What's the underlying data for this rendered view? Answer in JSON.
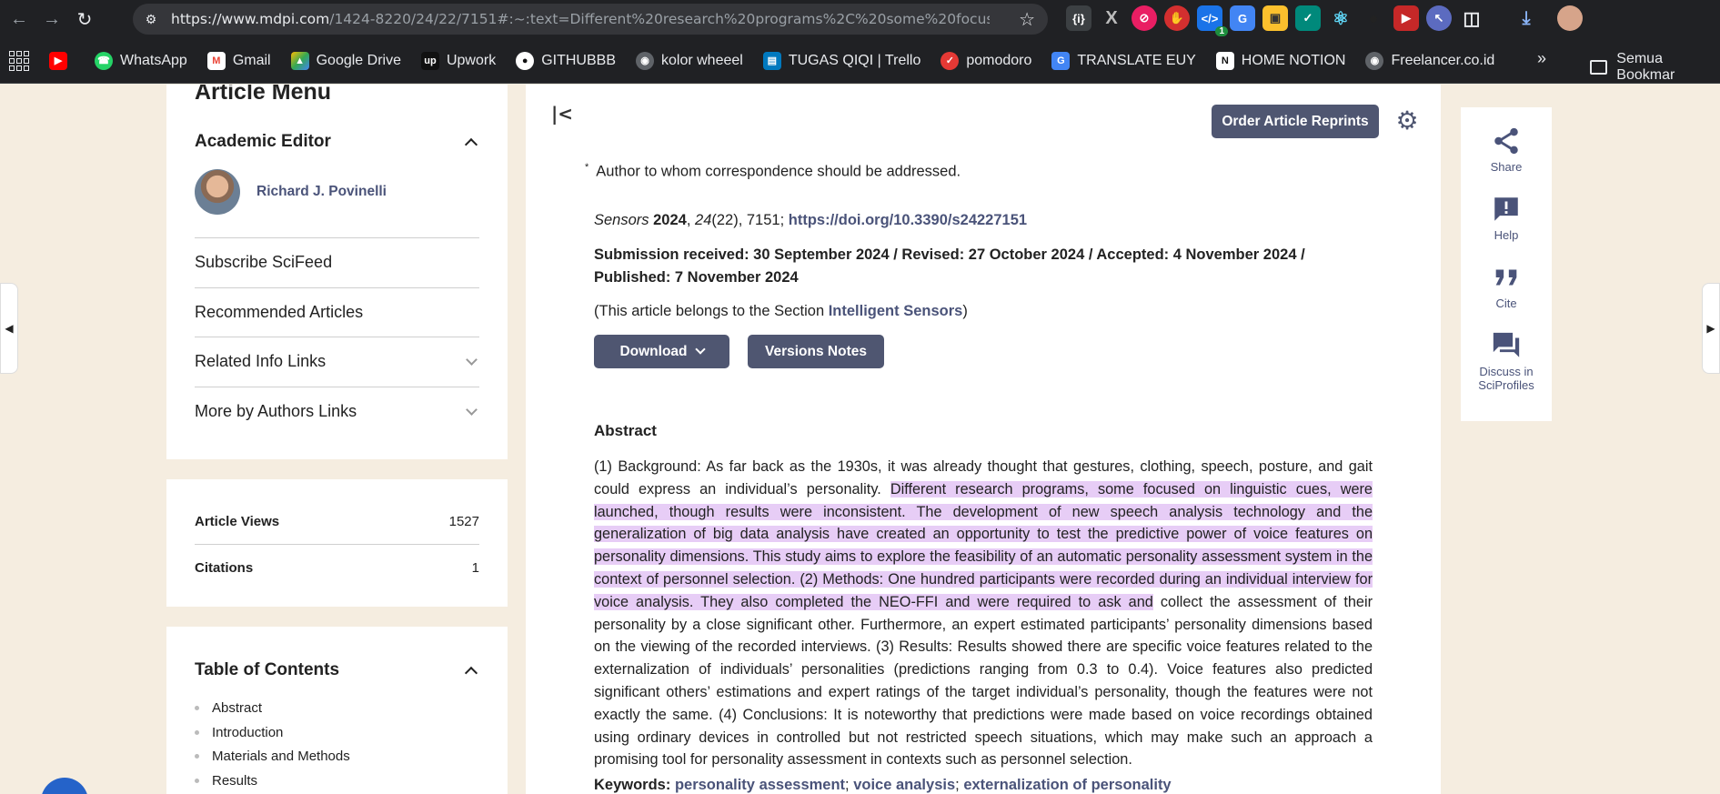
{
  "browser": {
    "url_host": "https://www.mdpi.com",
    "url_rest": "/1424-8220/24/22/7151#:~:text=Different%20research%20programs%2C%20some%20focus...",
    "extension_badge": "1",
    "bookmarks": [
      {
        "label": "",
        "icon": "youtube-icon",
        "color": "#ff0000"
      },
      {
        "label": "WhatsApp",
        "icon": "whatsapp-icon",
        "color": "#25d366"
      },
      {
        "label": "Gmail",
        "icon": "gmail-icon",
        "color": "#ea4335"
      },
      {
        "label": "Google Drive",
        "icon": "google-drive-icon",
        "color": "#fbbc04"
      },
      {
        "label": "Upwork",
        "icon": "upwork-icon",
        "color": "#111111"
      },
      {
        "label": "GITHUBBB",
        "icon": "github-icon",
        "color": "#111111"
      },
      {
        "label": "kolor wheeel",
        "icon": "globe-icon",
        "color": "#5f6368"
      },
      {
        "label": "TUGAS QIQI | Trello",
        "icon": "trello-icon",
        "color": "#0079bf"
      },
      {
        "label": "pomodoro",
        "icon": "pomodoro-icon",
        "color": "#e53935"
      },
      {
        "label": "TRANSLATE EUY",
        "icon": "translate-icon",
        "color": "#4285f4"
      },
      {
        "label": "HOME NOTION",
        "icon": "notion-icon",
        "color": "#ffffff"
      },
      {
        "label": "Freelancer.co.id",
        "icon": "globe-icon",
        "color": "#5f6368"
      }
    ],
    "bookmarks_folder": "Semua Bookmar"
  },
  "sidebar": {
    "menu_title": "Article Menu",
    "academic_editor_heading": "Academic Editor",
    "editor_name": "Richard J. Povinelli",
    "menu_items": [
      "Subscribe SciFeed",
      "Recommended Articles",
      "Related Info Links",
      "More by Authors Links"
    ],
    "stats": [
      {
        "label": "Article Views",
        "value": "1527"
      },
      {
        "label": "Citations",
        "value": "1"
      }
    ],
    "toc_heading": "Table of Contents",
    "toc_items": [
      "Abstract",
      "Introduction",
      "Materials and Methods",
      "Results"
    ]
  },
  "article": {
    "reprint_button": "Order Article Reprints",
    "corresponding_mark": "*",
    "corresponding_note": "Author to whom correspondence should be addressed.",
    "journal": "Sensors",
    "year": "2024",
    "volume": "24",
    "issue_article": "(22), 7151; ",
    "doi": "https://doi.org/10.3390/s24227151",
    "dates_line1": "Submission received: 30 September 2024 / Revised: 27 October 2024 / Accepted: 4 November 2024 /",
    "dates_line2": "Published: 7 November 2024",
    "section_prefix": "(This article belongs to the Section ",
    "section_name": "Intelligent Sensors",
    "section_suffix": ")",
    "download_button": "Download",
    "versions_button": "Versions Notes",
    "abstract_title": "Abstract",
    "abstract_before": "(1) Background: As far back as the 1930s, it was already thought that gestures, clothing, speech, posture, and gait could express an individual’s personality. ",
    "abstract_highlight": "Different research programs, some focused on linguistic cues, were launched, though results were inconsistent. The development of new speech analysis technology and the generalization of big data analysis have created an opportunity to test the predictive power of voice features on personality dimensions. This study aims to explore the feasibility of an automatic personality assessment system in the context of personnel selection. (2) Methods: One hundred participants were recorded during an individual interview for voice analysis. They also completed the NEO-FFI and were required to ask and",
    "abstract_after": " collect the assessment of their personality by a close significant other. Furthermore, an expert estimated participants’ personality dimensions based on the viewing of the recorded interviews. (3) Results: Results showed there are specific voice features related to the externalization of individuals’ personalities (predictions ranging from 0.3 to 0.4). Voice features also predicted significant others’ estimations and expert ratings of the target individual’s personality, though the features were not exactly the same. (4) Conclusions: It is noteworthy that predictions were made based on voice recordings obtained using ordinary devices in controlled but not restricted speech situations, which may make such an approach a promising tool for personality assessment in contexts such as personnel selection.",
    "keywords_label": "Keywords:",
    "keywords": [
      "personality assessment",
      "voice analysis",
      "externalization of personality"
    ]
  },
  "right_menu": [
    {
      "label": "Share",
      "icon": "share-icon"
    },
    {
      "label": "Help",
      "icon": "help-icon"
    },
    {
      "label": "Cite",
      "icon": "quote-icon"
    },
    {
      "label": "Discuss in SciProfiles",
      "icon": "discuss-icon"
    }
  ],
  "colors": {
    "accent": "#4f5671",
    "link": "#4a5379",
    "highlight": "#e7cdf6",
    "page_bg": "#f5ede0"
  }
}
